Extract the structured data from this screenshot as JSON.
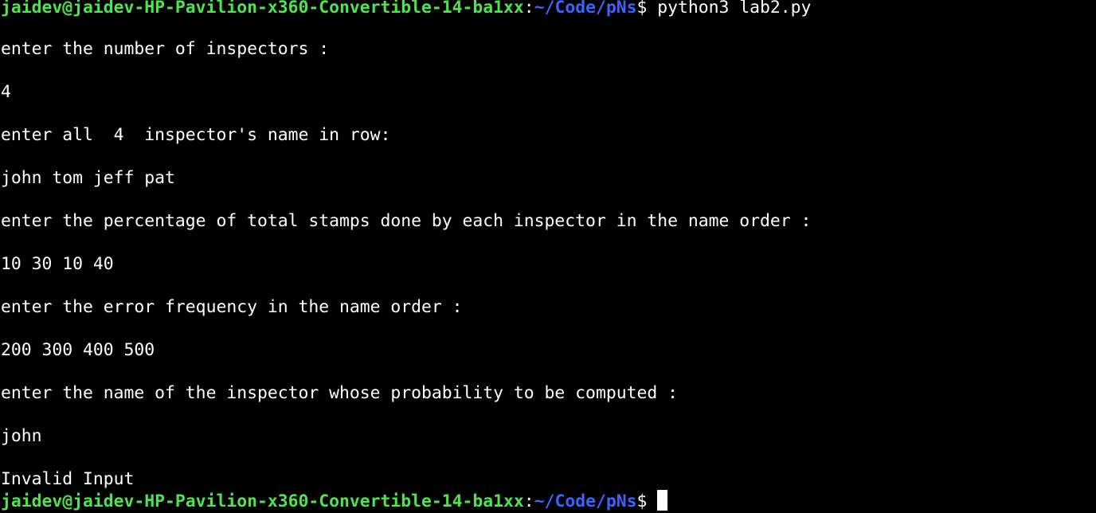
{
  "prompt": {
    "user_host": "jaidev@jaidev-HP-Pavilion-x360-Convertible-14-ba1xx",
    "colon": ":",
    "path": "~/Code/pNs",
    "symbol": "$",
    "command": " python3 lab2.py",
    "final_symbol": "$ "
  },
  "output": [
    "enter the number of inspectors :",
    "4",
    "enter all  4  inspector's name in row:",
    "john tom jeff pat",
    "enter the percentage of total stamps done by each inspector in the name order :",
    "10 30 10 40",
    "enter the error frequency in the name order :",
    "200 300 400 500",
    "enter the name of the inspector whose probability to be computed :",
    "john",
    "Invalid Input"
  ],
  "colors": {
    "background": "#000000",
    "user_host": "#4fe34f",
    "path": "#3b63ff",
    "text": "#ffffff"
  }
}
